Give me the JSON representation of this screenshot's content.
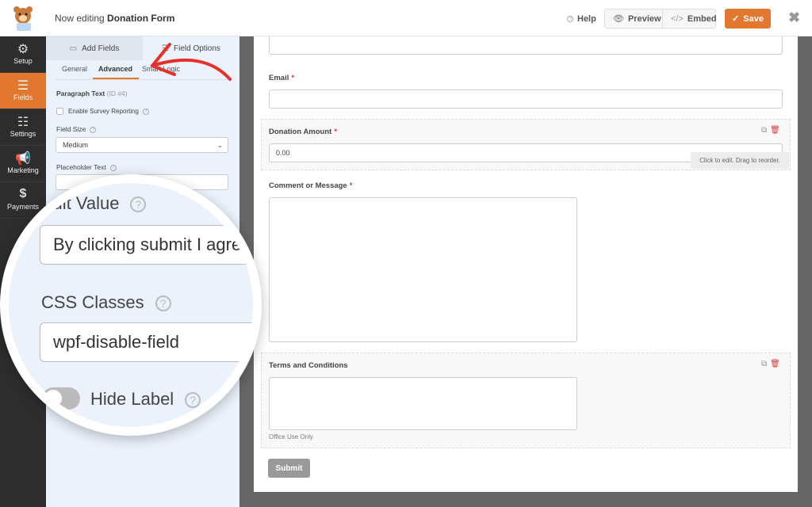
{
  "header": {
    "title_prefix": "Now editing",
    "form_name": "Donation Form",
    "help": "Help",
    "preview": "Preview",
    "embed": "Embed",
    "save": "Save"
  },
  "sidebar": {
    "items": [
      {
        "label": "Setup",
        "icon": "gear-icon"
      },
      {
        "label": "Fields",
        "icon": "list-icon",
        "active": true
      },
      {
        "label": "Settings",
        "icon": "sliders-icon"
      },
      {
        "label": "Marketing",
        "icon": "megaphone-icon"
      },
      {
        "label": "Payments",
        "icon": "dollar-icon"
      }
    ]
  },
  "panel": {
    "tabs": [
      "Add Fields",
      "Field Options"
    ],
    "subtabs": [
      "General",
      "Advanced",
      "Smart Logic"
    ],
    "field_title": "Paragraph Text",
    "field_id": "(ID #4)",
    "survey_label": "Enable Survey Reporting",
    "field_size_label": "Field Size",
    "field_size_value": "Medium",
    "placeholder_label": "Placeholder Text",
    "placeholder_value": ""
  },
  "magnifier": {
    "default_value_label": "Default Value",
    "default_value": "By clicking submit I agree",
    "css_label": "CSS Classes",
    "css_value": "wpf-disable-field",
    "hide_label": "Hide Label",
    "hide_label_on": false
  },
  "form": {
    "email_label": "Email",
    "donation_label": "Donation Amount",
    "donation_value": "0.00",
    "tooltip": "Click to edit. Drag to reorder.",
    "comment_label": "Comment or Message",
    "terms_label": "Terms and Conditions",
    "terms_desc": "Office Use Only",
    "submit": "Submit"
  },
  "colors": {
    "accent": "#e27730",
    "required": "#d63638"
  }
}
